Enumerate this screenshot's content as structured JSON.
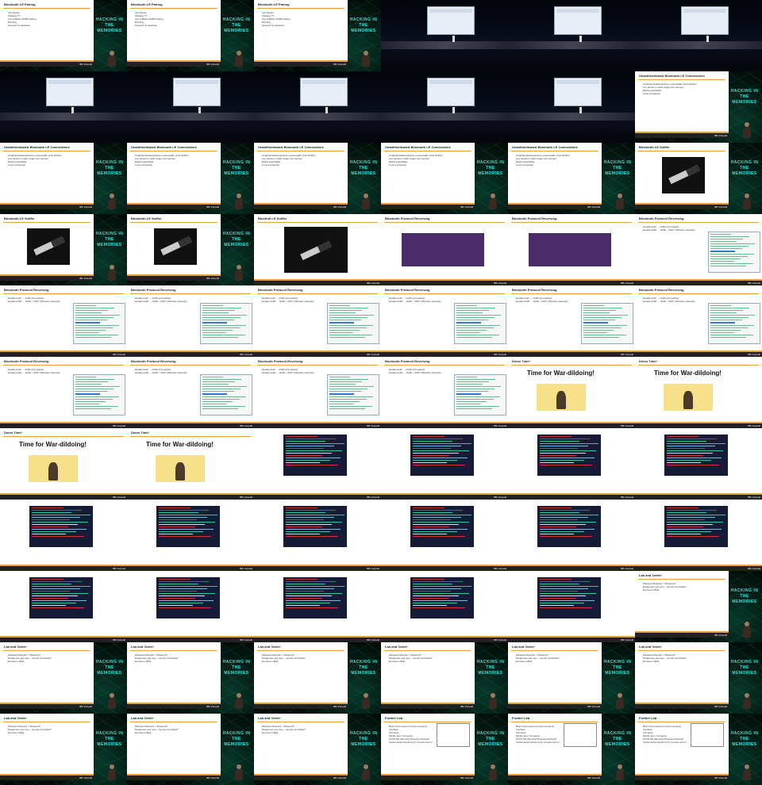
{
  "logo": "IBC Consult",
  "brand": "HACKING IN THE MEMORIES",
  "slides": {
    "pairing": {
      "title": "Bluetooth LE Pairing",
      "bullets": [
        "Just Works",
        "Passkey ??",
        "Out of Band (OOB) Pairing",
        "Bonding",
        "Numeric Comparison"
      ]
    },
    "unauth": {
      "title": "Unauthenticated Bluetooth LE Connections",
      "bullets": [
        "Unauthenticated devices connectable (Just Works)",
        "Any device in radio range can connect",
        "Easily exploitable",
        "Lock-out bypass"
      ]
    },
    "sniffer": {
      "title": "Bluetooth LE Sniffer",
      "alt_title": "Bluefruit LE Sniffer"
    },
    "reversing": {
      "title": "Bluetooth Protocol Reversing",
      "bullets": [
        "Handle 0x1F → 0x0D (Init packet)",
        "Handle 0x2D → 0x0D – 0xFF (Vibration Intensity)"
      ]
    },
    "demo": {
      "title": "Demo Time!",
      "text": "Time for War-dildoing!"
    },
    "lab": {
      "title": "Lab and Order!",
      "bullets": [
        "Wireless Pleasure = Pleasure?",
        "Dangerous sex toys – remote controlled?",
        "Remote in BLE"
      ]
    },
    "further": {
      "title": "Further Lab",
      "bullets": [
        "BLE control panel (remote sessions)",
        "Interface",
        "Firmware",
        "Mobile app / Company",
        "HTTP API (Remote Pleasure Network)",
        "Implemented solutions for remote control"
      ]
    }
  },
  "cells": [
    "pairing",
    "pairing",
    "pairing",
    "hall",
    "hall",
    "hall",
    "hall",
    "hall",
    "hall",
    "hall",
    "hall",
    "unauth",
    "unauth",
    "unauth",
    "unauth",
    "unauth",
    "unauth",
    "sniffer",
    "sniffer",
    "sniffer",
    "sniffer-full",
    "toy",
    "toy",
    "wireshark",
    "wireshark",
    "wireshark",
    "wireshark",
    "wireshark",
    "wireshark",
    "wireshark",
    "wireshark",
    "wireshark",
    "wireshark",
    "wireshark",
    "demo-full",
    "demo-full",
    "demo-full",
    "demo-full",
    "term",
    "term",
    "term",
    "term",
    "term",
    "term",
    "term",
    "term",
    "term",
    "term",
    "term",
    "term",
    "term",
    "term",
    "term",
    "lab",
    "lab",
    "lab",
    "lab",
    "lab",
    "lab",
    "lab",
    "lab",
    "lab",
    "lab",
    "further",
    "further",
    "further"
  ]
}
